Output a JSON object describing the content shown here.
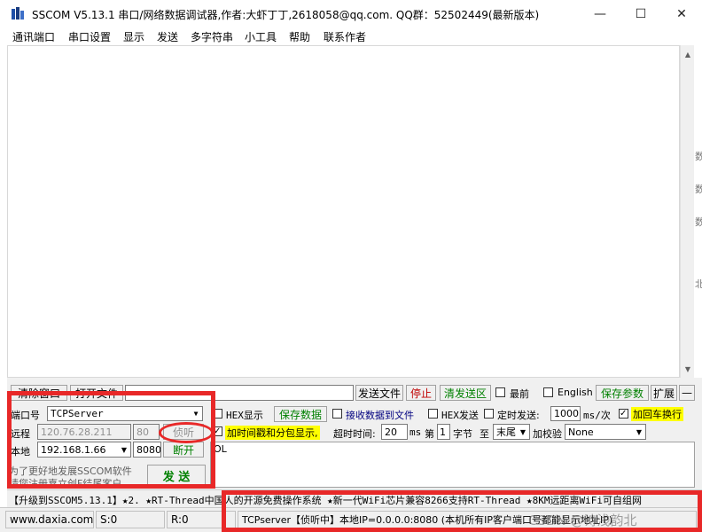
{
  "window": {
    "title": "SSCOM V5.13.1 串口/网络数据调试器,作者:大虾丁丁,2618058@qq.com. QQ群：52502449(最新版本)",
    "controls": {
      "minimize": "—",
      "maximize": "☐",
      "close": "✕"
    }
  },
  "menu": [
    "通讯端口",
    "串口设置",
    "显示",
    "发送",
    "多字符串",
    "小工具",
    "帮助",
    "联系作者"
  ],
  "right_edge_texts": [
    "数",
    "数",
    "数",
    "北"
  ],
  "toolbar": {
    "clear_window": "清除窗口",
    "open_file": "打开文件",
    "send_file": "发送文件",
    "stop": "停止",
    "clear_send": "清发送区",
    "topmost": "最前",
    "english": "English",
    "save_params": "保存参数",
    "expand": "扩展",
    "collapse": "—"
  },
  "connection": {
    "port_label": "端口号",
    "port_value": "TCPServer",
    "remote_label": "远程",
    "remote_ip": "120.76.28.211",
    "remote_port": "80",
    "listen_button": "侦听",
    "local_label": "本地",
    "local_ip": "192.168.1.66",
    "local_port": "8080",
    "disconnect_button": "断开"
  },
  "options": {
    "hex_display": "HEX显示",
    "save_data": "保存数据",
    "receive_to_file": "接收数据到文件",
    "hex_send": "HEX发送",
    "timed_send": "定时发送:",
    "interval": "1000",
    "interval_unit": "ms/次",
    "add_crlf": "加回车换行",
    "add_timestamp": "加时间戳和分包显示,",
    "timeout_label": "超时时间:",
    "timeout_value": "20",
    "timeout_unit": "ms",
    "byte_from_label": "第",
    "byte_from": "1",
    "byte_unit": "字节",
    "to_label": "至",
    "to_value": "末尾",
    "checksum_label": "加校验",
    "checksum_value": "None"
  },
  "send_area": {
    "text": "OL",
    "send_button": "发  送"
  },
  "promo": {
    "line1": "为了更好地发展SSCOM软件",
    "line2": "请您注册嘉立创F结尾客户"
  },
  "upgrade_bar": "【升级到SSCOM5.13.1】★2. ★RT-Thread中国人的开源免费操作系统 ★新一代WiFi芯片兼容8266支持RT-Thread ★8KM远距离WiFi可自组网",
  "status": {
    "website": "www.daxia.com",
    "sent": "S:0",
    "received": "R:0",
    "message": "TCPserver【侦听中】本地IP=0.0.0.0:8080 (本机所有IP客户端口号都能显示地址IP)",
    "watermark": "CSDN @诗浅韵北"
  },
  "colors": {
    "highlight_box": "#e82828",
    "green_text": "#008000",
    "red_text": "#c00000",
    "yellow_label": "#ffff00"
  }
}
